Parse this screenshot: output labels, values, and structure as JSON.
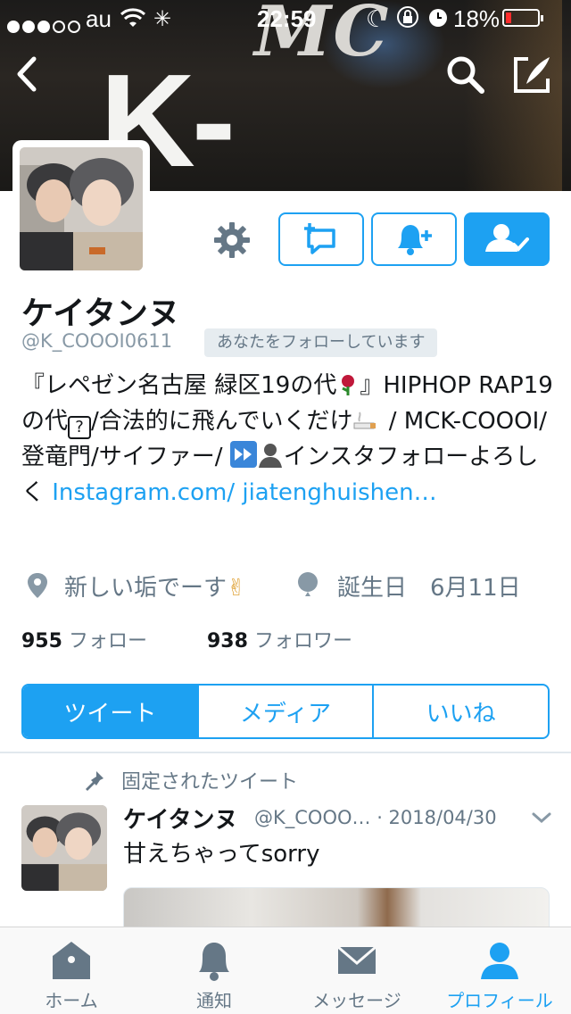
{
  "status_bar": {
    "carrier": "au",
    "time": "22:59",
    "battery_percent": "18%",
    "battery_level": 0.18,
    "signal_bars_filled": 3,
    "signal_bars_total": 5
  },
  "banner": {
    "line1": "MC",
    "line2": "K-COOOI"
  },
  "header_icons": [
    "back-icon",
    "search-icon",
    "compose-icon"
  ],
  "profile": {
    "name": "ケイタンヌ",
    "handle": "@K_COOOI0611",
    "follows_you": "あなたをフォローしています",
    "bio_part1": "『レペゼン名古屋 緑区19の代",
    "bio_part2": "』HIPHOP RAP19の代",
    "bio_part3": "/合法的に飛んでいくだけ",
    "bio_part4": " / MCK-COOOI/登竜門/サイファー/ ",
    "bio_part5": "インスタフォローよろしく ",
    "bio_link": "Instagram.com/ jiatenghuishen…",
    "location": "新しい垢でーす",
    "birthday": "誕生日　6月11日"
  },
  "stats": {
    "following_count": "955",
    "following_label": "フォロー",
    "followers_count": "938",
    "followers_label": "フォロワー"
  },
  "tabs": [
    {
      "label": "ツイート",
      "active": true
    },
    {
      "label": "メディア",
      "active": false
    },
    {
      "label": "いいね",
      "active": false
    }
  ],
  "pinned_tweet": {
    "pinned_label": "固定されたツイート",
    "name": "ケイタンヌ",
    "handle_date": "@K_COOO… · 2018/04/30",
    "text": "甘えちゃってsorry"
  },
  "tab_bar": [
    {
      "label": "ホーム",
      "icon": "home-icon",
      "active": false
    },
    {
      "label": "通知",
      "icon": "bell-icon",
      "active": false
    },
    {
      "label": "メッセージ",
      "icon": "mail-icon",
      "active": false
    },
    {
      "label": "プロフィール",
      "icon": "person-icon",
      "active": true
    }
  ],
  "colors": {
    "accent": "#1da1f2",
    "text": "#14171a",
    "muted": "#657786",
    "battery_low": "#ff2d2d"
  }
}
